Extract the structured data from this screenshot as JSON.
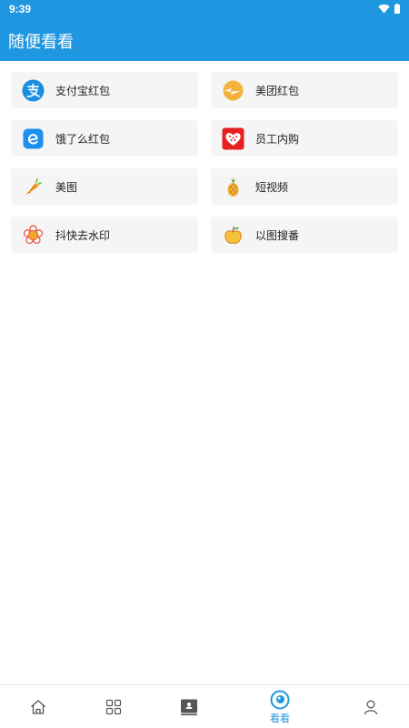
{
  "status": {
    "time": "9:39"
  },
  "appbar": {
    "title": "随便看看"
  },
  "items": [
    {
      "label": "支付宝红包",
      "icon": "alipay-icon"
    },
    {
      "label": "美团红包",
      "icon": "meituan-icon"
    },
    {
      "label": "饿了么红包",
      "icon": "eleme-icon"
    },
    {
      "label": "员工内购",
      "icon": "heart-shop-icon"
    },
    {
      "label": "美图",
      "icon": "carrot-icon"
    },
    {
      "label": "短视频",
      "icon": "pineapple-icon"
    },
    {
      "label": "抖快去水印",
      "icon": "flower-icon"
    },
    {
      "label": "以图搜番",
      "icon": "apple-icon"
    }
  ],
  "nav": {
    "active_label": "看看"
  },
  "colors": {
    "primary": "#1e97e0",
    "card": "#f5f5f5"
  }
}
